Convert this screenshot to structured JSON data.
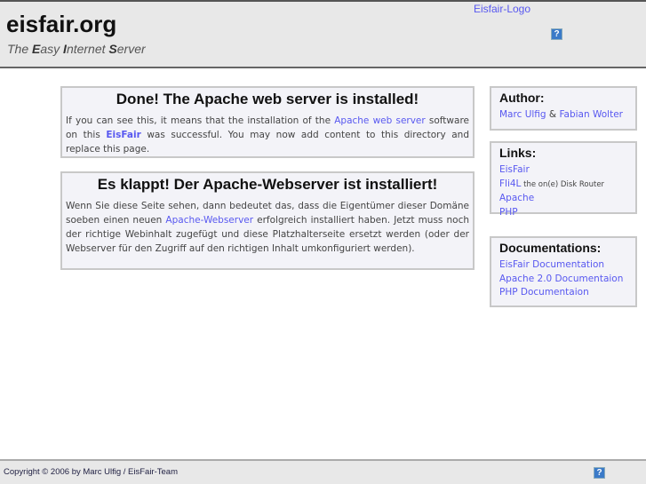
{
  "header": {
    "site_title": "eisfair.org",
    "slogan": [
      {
        "b": "E",
        "t": "asy "
      },
      {
        "b": "I",
        "t": "nternet "
      },
      {
        "b": "S",
        "t": "erver"
      }
    ],
    "slogan_prefix": "The ",
    "logo_alt": "Eisfair-Logo",
    "help_icon": "?"
  },
  "main": {
    "en": {
      "title": "Done! The Apache web server is installed!",
      "p1": "If you can see this, it means that the installation of the ",
      "link1": "Apache web server",
      "p2": " software on this ",
      "link2": "EisFair",
      "p3": " was successful. You may now add content to this directory and replace this page."
    },
    "de": {
      "title": "Es klappt! Der Apache-Webserver ist installiert!",
      "p1": "Wenn Sie diese Seite sehen, dann bedeutet das, dass die Eigentümer dieser Domäne soeben einen neuen ",
      "link1": "Apache-Webserver",
      "p2": " erfolgreich installiert haben. Jetzt muss noch der richtige Webinhalt zugefügt und diese Platzhalterseite ersetzt werden (oder der Webserver für den Zugriff auf den richtigen Inhalt umkonfiguriert werden)."
    }
  },
  "sidebar": {
    "author": {
      "title": "Author:",
      "name1": "Marc Ulfig",
      "amp": " & ",
      "name2": "Fabian Wolter"
    },
    "links": {
      "title": "Links:",
      "items": [
        "EisFair",
        "Fli4L",
        "Apache",
        "PHP"
      ],
      "fli4l_note": " the on(e) Disk Router"
    },
    "docs": {
      "title": "Documentations:",
      "items": [
        "EisFair Documentation",
        "Apache 2.0 Documentaion",
        "PHP Documentaion"
      ]
    }
  },
  "footer": {
    "copyright": "Copyright © 2006 by Marc Ulfig / EisFair-Team",
    "help_icon": "?"
  },
  "colors": {
    "link": "#5858f0",
    "header_bg": "#e8e8e8",
    "box_bg": "#f3f3f8"
  }
}
